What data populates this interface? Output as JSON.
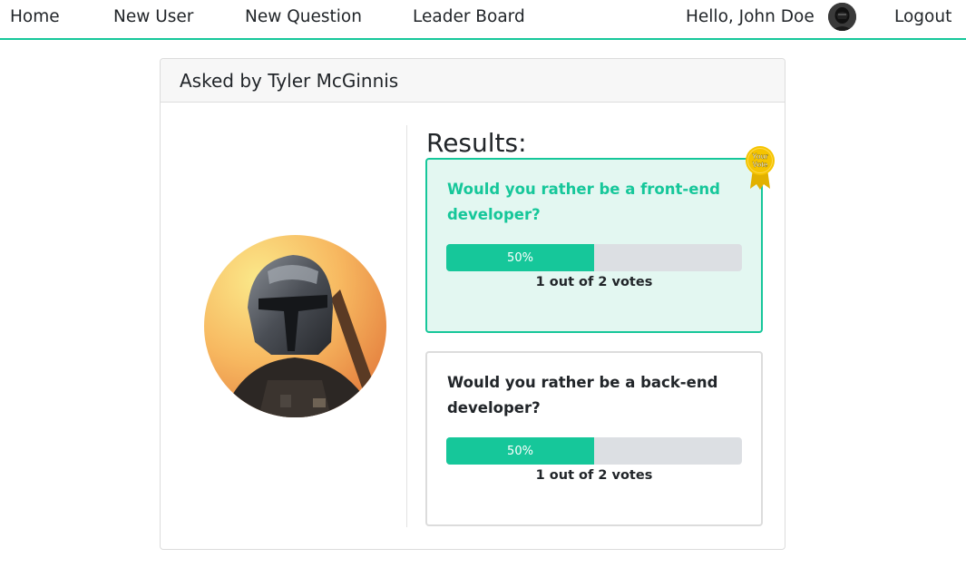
{
  "nav": {
    "home": "Home",
    "new_user": "New User",
    "new_question": "New Question",
    "leader_board": "Leader Board",
    "greeting": "Hello, John Doe",
    "logout": "Logout"
  },
  "question": {
    "header": "Asked by Tyler McGinnis",
    "results_title": "Results:",
    "badge_text_line1": "Your",
    "badge_text_line2": "Vote",
    "options": [
      {
        "text": "Would you rather be a front-end developer?",
        "percent_label": "50%",
        "percent": 50,
        "votes_text": "1 out of 2 votes",
        "is_user_vote": true
      },
      {
        "text": "Would you rather be a back-end developer?",
        "percent_label": "50%",
        "percent": 50,
        "votes_text": "1 out of 2 votes",
        "is_user_vote": false
      }
    ]
  },
  "colors": {
    "accent": "#16c79a",
    "voted_bg": "#e3f7f1",
    "badge": "#f5c400"
  }
}
